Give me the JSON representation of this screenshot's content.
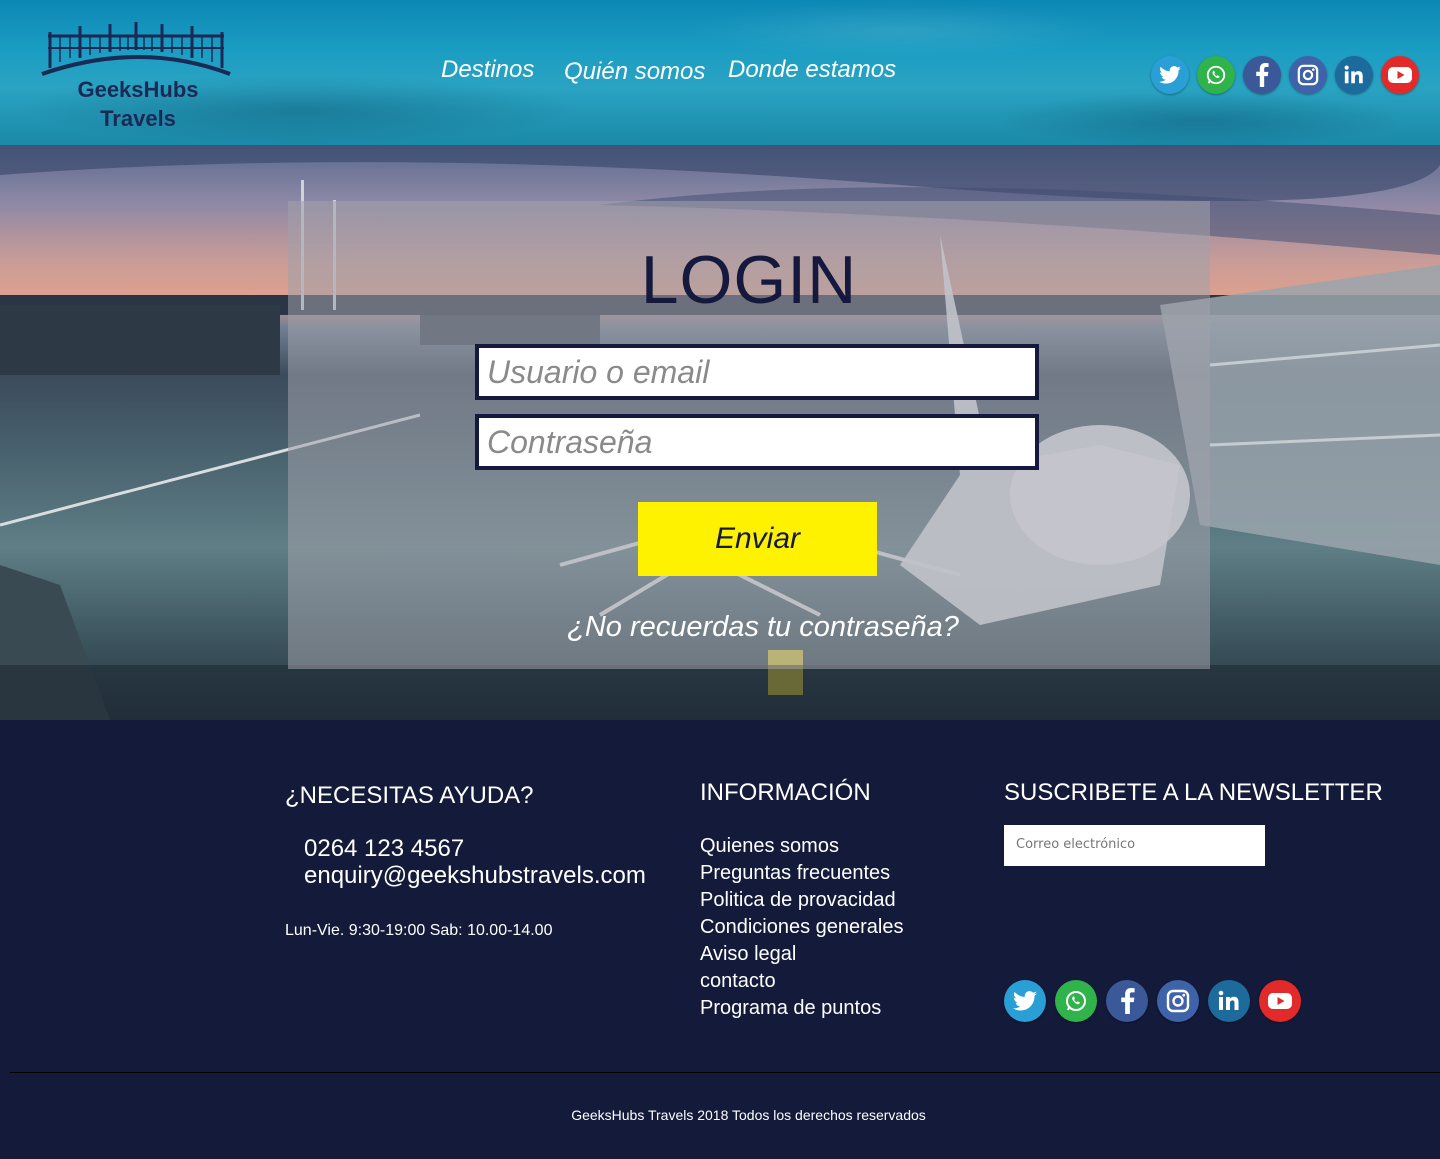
{
  "header": {
    "logo_line1": "GeeksHubs",
    "logo_line2": "Travels",
    "nav": [
      {
        "label": "Destinos"
      },
      {
        "label": "Quién somos"
      },
      {
        "label": "Donde estamos"
      }
    ],
    "social": [
      "twitter-icon",
      "whatsapp-icon",
      "facebook-icon",
      "instagram-icon",
      "linkedin-icon",
      "youtube-icon"
    ]
  },
  "login": {
    "title": "LOGIN",
    "user_placeholder": "Usuario o email",
    "pass_placeholder": "Contraseña",
    "submit_label": "Enviar",
    "forgot_label": "¿No recuerdas tu contraseña?"
  },
  "footer": {
    "help_heading": "¿NECESITAS AYUDA?",
    "phone": "0264 123 4567",
    "email": "enquiry@geekshubstravels.com",
    "hours": "Lun-Vie. 9:30-19:00 Sab: 10.00-14.00",
    "info_heading": "INFORMACIÓN",
    "info_links": [
      "Quienes somos",
      "Preguntas frecuentes",
      "Politica de provacidad",
      "Condiciones generales",
      "Aviso legal",
      "contacto",
      "Programa de puntos"
    ],
    "newsletter_heading": "SUSCRIBETE A LA NEWSLETTER",
    "newsletter_placeholder": "Correo electrónico",
    "copyright": "GeeksHubs Travels 2018 Todos los derechos reservados"
  },
  "colors": {
    "navy": "#15193d",
    "footer_bg": "#141a3a",
    "button_yellow": "#fff200",
    "twitter": "#2a9fd6",
    "whatsapp": "#2fb34a",
    "facebook": "#3b5998",
    "instagram": "#3f63a8",
    "linkedin": "#1d6a9c",
    "youtube": "#e32a2a"
  }
}
